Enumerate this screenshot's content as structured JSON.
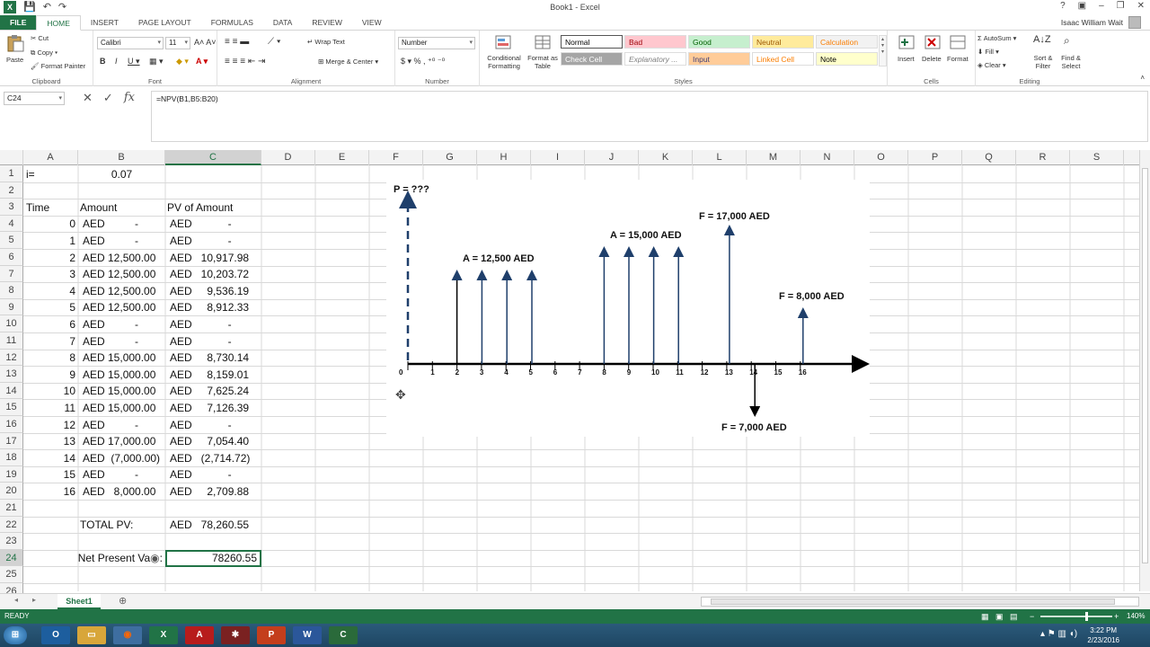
{
  "app": {
    "title": "Book1 - Excel",
    "user": "Isaac William Wait"
  },
  "tabs": [
    "FILE",
    "HOME",
    "INSERT",
    "PAGE LAYOUT",
    "FORMULAS",
    "DATA",
    "REVIEW",
    "VIEW"
  ],
  "ribbon": {
    "clipboard": {
      "paste": "Paste",
      "cut": "Cut",
      "copy": "Copy",
      "format_painter": "Format Painter",
      "label": "Clipboard"
    },
    "font": {
      "name": "Calibri",
      "size": "11",
      "label": "Font"
    },
    "alignment": {
      "wrap_text": "Wrap Text",
      "merge_center": "Merge & Center",
      "label": "Alignment"
    },
    "number": {
      "format": "Number",
      "label": "Number"
    },
    "styles": {
      "conditional": "Conditional Formatting",
      "format_table": "Format as Table",
      "cells": [
        {
          "name": "Normal",
          "bg": "#ffffff",
          "fg": "#000000"
        },
        {
          "name": "Bad",
          "bg": "#ffc7ce",
          "fg": "#9c0006"
        },
        {
          "name": "Good",
          "bg": "#c6efce",
          "fg": "#006100"
        },
        {
          "name": "Neutral",
          "bg": "#ffeb9c",
          "fg": "#9c5700"
        },
        {
          "name": "Calculation",
          "bg": "#f2f2f2",
          "fg": "#fa7d00"
        },
        {
          "name": "Check Cell",
          "bg": "#a5a5a5",
          "fg": "#ffffff"
        },
        {
          "name": "Explanatory ...",
          "bg": "#ffffff",
          "fg": "#7f7f7f"
        },
        {
          "name": "Input",
          "bg": "#ffcc99",
          "fg": "#3f3f76"
        },
        {
          "name": "Linked Cell",
          "bg": "#ffffff",
          "fg": "#fa7d00"
        },
        {
          "name": "Note",
          "bg": "#ffffcc",
          "fg": "#000000"
        }
      ],
      "label": "Styles"
    },
    "cells": {
      "insert": "Insert",
      "delete": "Delete",
      "format": "Format",
      "label": "Cells"
    },
    "editing": {
      "autosum": "AutoSum",
      "fill": "Fill",
      "clear": "Clear",
      "sort": "Sort & Filter",
      "find": "Find & Select",
      "label": "Editing"
    }
  },
  "formula_bar": {
    "name_box": "C24",
    "formula": "=NPV(B1,B5:B20)"
  },
  "columns": [
    "A",
    "B",
    "C",
    "D",
    "E",
    "F",
    "G",
    "H",
    "I",
    "J",
    "K",
    "L",
    "M",
    "N",
    "O",
    "P",
    "Q",
    "R",
    "S"
  ],
  "rows": [
    "1",
    "2",
    "3",
    "4",
    "5",
    "6",
    "7",
    "8",
    "9",
    "10",
    "11",
    "12",
    "13",
    "14",
    "15",
    "16",
    "17",
    "18",
    "19",
    "20",
    "21",
    "22",
    "23",
    "24",
    "25",
    "26"
  ],
  "sheet": {
    "a1": "i=",
    "b1": "0.07",
    "a3": "Time",
    "b3": "Amount",
    "c3": "PV of Amount",
    "table": [
      {
        "t": "0",
        "amt": "AED          -",
        "pv": "AED            -"
      },
      {
        "t": "1",
        "amt": "AED          -",
        "pv": "AED            -"
      },
      {
        "t": "2",
        "amt": "AED 12,500.00",
        "pv": "AED   10,917.98"
      },
      {
        "t": "3",
        "amt": "AED 12,500.00",
        "pv": "AED   10,203.72"
      },
      {
        "t": "4",
        "amt": "AED 12,500.00",
        "pv": "AED     9,536.19"
      },
      {
        "t": "5",
        "amt": "AED 12,500.00",
        "pv": "AED     8,912.33"
      },
      {
        "t": "6",
        "amt": "AED          -",
        "pv": "AED            -"
      },
      {
        "t": "7",
        "amt": "AED          -",
        "pv": "AED            -"
      },
      {
        "t": "8",
        "amt": "AED 15,000.00",
        "pv": "AED     8,730.14"
      },
      {
        "t": "9",
        "amt": "AED 15,000.00",
        "pv": "AED     8,159.01"
      },
      {
        "t": "10",
        "amt": "AED 15,000.00",
        "pv": "AED     7,625.24"
      },
      {
        "t": "11",
        "amt": "AED 15,000.00",
        "pv": "AED     7,126.39"
      },
      {
        "t": "12",
        "amt": "AED          -",
        "pv": "AED            -"
      },
      {
        "t": "13",
        "amt": "AED 17,000.00",
        "pv": "AED     7,054.40"
      },
      {
        "t": "14",
        "amt": "AED  (7,000.00)",
        "pv": "AED   (2,714.72)"
      },
      {
        "t": "15",
        "amt": "AED          -",
        "pv": "AED            -"
      },
      {
        "t": "16",
        "amt": "AED   8,000.00",
        "pv": "AED     2,709.88"
      }
    ],
    "b22": "TOTAL PV:",
    "c22": "AED   78,260.55",
    "a24": "Net Present Va",
    "c24": "78260.55"
  },
  "diagram": {
    "p_label": "P = ???",
    "a1_label": "A = 12,500 AED",
    "a2_label": "A = 15,000 AED",
    "f17_label": "F = 17,000 AED",
    "f8_label": "F = 8,000 AED",
    "f7_label": "F = 7,000 AED",
    "ticks": [
      "0",
      "1",
      "2",
      "3",
      "4",
      "5",
      "6",
      "7",
      "8",
      "9",
      "10",
      "11",
      "12",
      "13",
      "14",
      "15",
      "16"
    ]
  },
  "sheet_tab": "Sheet1",
  "status": "READY",
  "zoom": "140%",
  "clock": {
    "time": "3:22 PM",
    "date": "2/23/2016"
  }
}
